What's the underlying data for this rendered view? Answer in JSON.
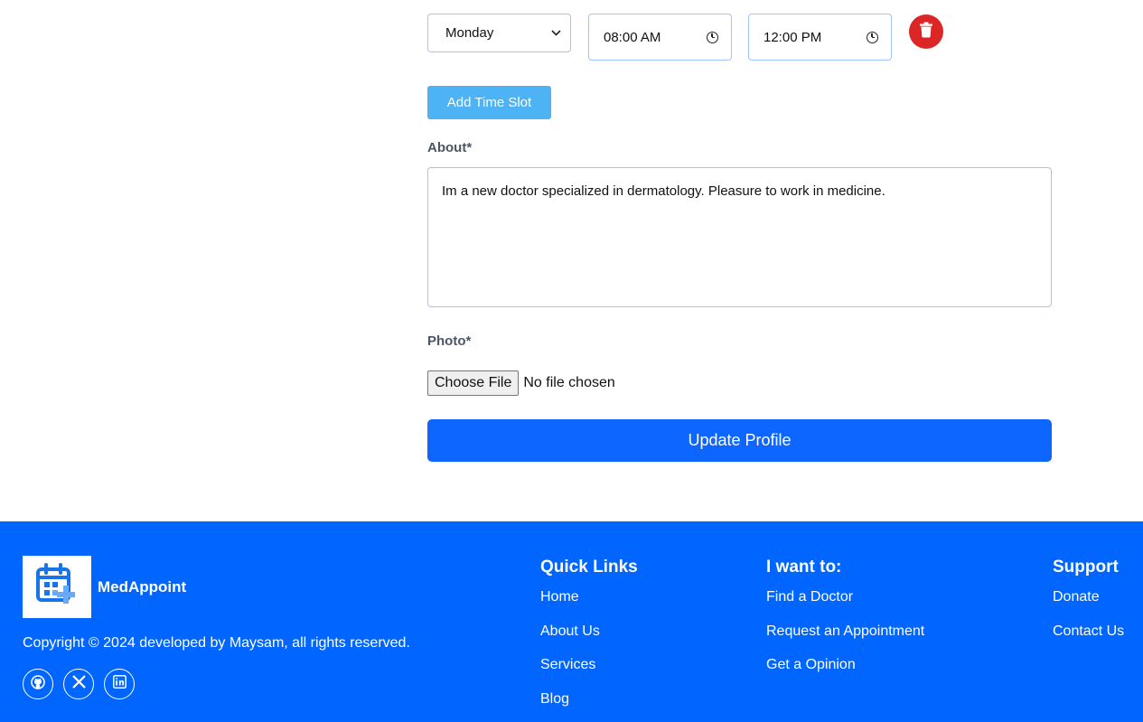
{
  "schedule": {
    "day_value": "Monday",
    "start_time": "08:00 AM",
    "end_time": "12:00 PM",
    "add_slot_label": "Add Time Slot"
  },
  "about": {
    "label": "About*",
    "value": "Im a new doctor specialized in dermatology. Pleasure to work in medicine."
  },
  "photo": {
    "label": "Photo*",
    "choose_label": "Choose File",
    "status": "No file chosen"
  },
  "update_label": "Update Profile",
  "footer": {
    "brand": "MedAppoint",
    "copyright": "Copyright © 2024 developed by Maysam, all rights reserved.",
    "socials": [
      "github-icon",
      "x-icon",
      "linkedin-icon"
    ],
    "quick_links": {
      "title": "Quick Links",
      "items": [
        "Home",
        "About Us",
        "Services",
        "Blog"
      ]
    },
    "want_to": {
      "title": "I want to:",
      "items": [
        "Find a Doctor",
        "Request an Appointment",
        "Get a Opinion"
      ]
    },
    "support": {
      "title": "Support",
      "items": [
        "Donate",
        "Contact Us"
      ]
    }
  },
  "colors": {
    "primary": "#0066ff",
    "add_slot": "#4db3f5",
    "delete": "#dc2626",
    "input_border": "#9ec5fe"
  }
}
